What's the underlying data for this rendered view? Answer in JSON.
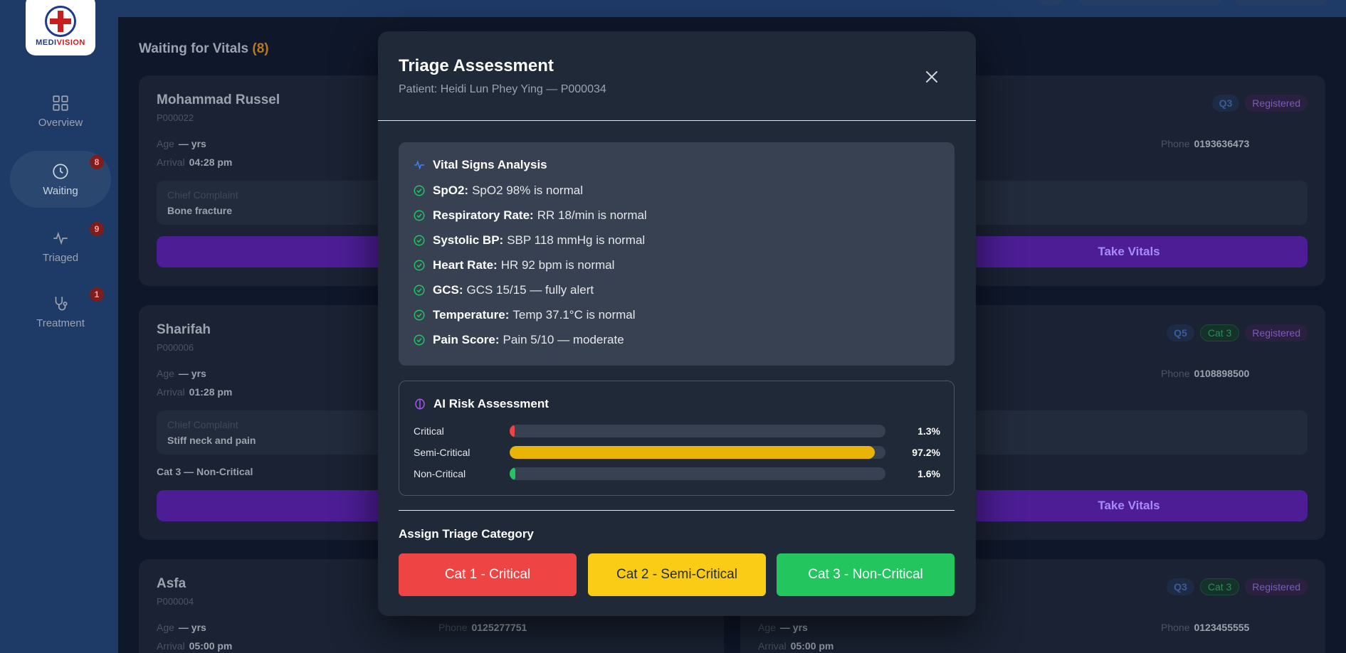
{
  "brand": {
    "part1": "MEDI",
    "part2": "VISION"
  },
  "sidebar": {
    "items": [
      {
        "label": "Overview",
        "badge": ""
      },
      {
        "label": "Waiting",
        "badge": "8"
      },
      {
        "label": "Triaged",
        "badge": "9"
      },
      {
        "label": "Treatment",
        "badge": "1"
      }
    ]
  },
  "waiting": {
    "title": "Waiting for Vitals",
    "count": "(8)",
    "labels": {
      "age": "Age",
      "arrival": "Arrival",
      "phone": "Phone",
      "complaint": "Chief Complaint",
      "take_vitals": "Take Vitals",
      "age_value": "— yrs"
    },
    "cards": [
      {
        "name": "Mohammad Russel",
        "pid": "P000022",
        "arrival": "04:28 pm",
        "complaint": "Bone fracture"
      },
      {
        "name": "Sharifah",
        "pid": "P000006",
        "arrival": "01:28 pm",
        "complaint": "Stiff neck and pain",
        "category": "Cat 3 — Non-Critical"
      },
      {
        "name": "Asfa",
        "pid": "P000004",
        "arrival": "05:00 pm",
        "phone": "0125277751"
      }
    ],
    "right_cards": [
      {
        "queue": "Q3",
        "status": "Registered",
        "phone": "0193636473"
      },
      {
        "queue": "Q5",
        "category": "Cat 3",
        "status": "Registered",
        "phone": "0108898500"
      },
      {
        "queue": "Q3",
        "category": "Cat 3",
        "status": "Registered",
        "phone": "0123455555",
        "arrival": "05:00 pm"
      }
    ]
  },
  "modal": {
    "title": "Triage Assessment",
    "subtitle": "Patient: Heidi Lun Phey Ying — P000034",
    "vitals_title": "Vital Signs Analysis",
    "vitals": [
      {
        "label": "SpO2:",
        "text": "SpO2 98% is normal"
      },
      {
        "label": "Respiratory Rate:",
        "text": "RR 18/min is normal"
      },
      {
        "label": "Systolic BP:",
        "text": "SBP 118 mmHg is normal"
      },
      {
        "label": "Heart Rate:",
        "text": "HR 92 bpm is normal"
      },
      {
        "label": "GCS:",
        "text": "GCS 15/15 — fully alert"
      },
      {
        "label": "Temperature:",
        "text": "Temp 37.1°C is normal"
      },
      {
        "label": "Pain Score:",
        "text": "Pain 5/10 — moderate"
      }
    ],
    "risk_title": "AI Risk Assessment",
    "risk": [
      {
        "label": "Critical",
        "value": 1.3,
        "display": "1.3%",
        "color": "#ef4444"
      },
      {
        "label": "Semi-Critical",
        "value": 97.2,
        "display": "97.2%",
        "color": "#eab308"
      },
      {
        "label": "Non-Critical",
        "value": 1.6,
        "display": "1.6%",
        "color": "#22c55e"
      }
    ],
    "assign_title": "Assign Triage Category",
    "buttons": [
      {
        "label": "Cat 1 - Critical",
        "bg": "#ef4444",
        "fg": "#ffffff"
      },
      {
        "label": "Cat 2 - Semi-Critical",
        "bg": "#facc15",
        "fg": "#1f2937"
      },
      {
        "label": "Cat 3 - Non-Critical",
        "bg": "#22c55e",
        "fg": "#ffffff"
      }
    ]
  },
  "colors": {
    "accent": "#7c3aed",
    "check": "#22c55e",
    "pulse": "#3b82f6",
    "brain": "#a855f7"
  }
}
